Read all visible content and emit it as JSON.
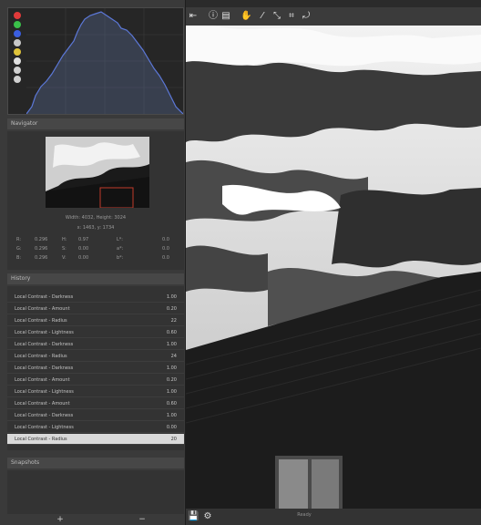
{
  "histogram": {
    "channel_buttons": [
      {
        "name": "red-channel",
        "color": "#e03a3a"
      },
      {
        "name": "green-channel",
        "color": "#3ac04a"
      },
      {
        "name": "blue-channel",
        "color": "#3a5ee0"
      },
      {
        "name": "luminance-channel",
        "color": "#c8c8c8"
      },
      {
        "name": "chroma-channel",
        "color": "#e0c43a"
      },
      {
        "name": "raw-channel",
        "color": "#e0e0e0"
      },
      {
        "name": "bar-toggle",
        "color": "#d0d0d0"
      },
      {
        "name": "mode-toggle",
        "color": "#d0d0d0"
      }
    ]
  },
  "navigator": {
    "title": "Navigator",
    "dimensions": "Width: 4032, Height: 3024",
    "coordinates": "x: 1463, y: 1734",
    "rows": [
      {
        "c1": "R:",
        "c2": "0.296",
        "c3": "H:",
        "c4": "0.97",
        "c5": "L*:",
        "c6": "0.0"
      },
      {
        "c1": "G:",
        "c2": "0.296",
        "c3": "S:",
        "c4": "0.00",
        "c5": "a*:",
        "c6": "0.0"
      },
      {
        "c1": "B:",
        "c2": "0.296",
        "c3": "V:",
        "c4": "0.00",
        "c5": "b*:",
        "c6": "0.0"
      }
    ]
  },
  "history": {
    "title": "History",
    "items": [
      {
        "label": "Local Contrast - Darkness",
        "value": "1.00"
      },
      {
        "label": "Local Contrast - Amount",
        "value": "0.20"
      },
      {
        "label": "Local Contrast - Radius",
        "value": "22"
      },
      {
        "label": "Local Contrast - Lightness",
        "value": "0.60"
      },
      {
        "label": "Local Contrast - Darkness",
        "value": "1.00"
      },
      {
        "label": "Local Contrast - Radius",
        "value": "24"
      },
      {
        "label": "Local Contrast - Darkness",
        "value": "1.00"
      },
      {
        "label": "Local Contrast - Amount",
        "value": "0.20"
      },
      {
        "label": "Local Contrast - Lightness",
        "value": "1.00"
      },
      {
        "label": "Local Contrast - Amount",
        "value": "0.60"
      },
      {
        "label": "Local Contrast - Darkness",
        "value": "1.00"
      },
      {
        "label": "Local Contrast - Lightness",
        "value": "0.00"
      },
      {
        "label": "Local Contrast - Radius",
        "value": "20"
      }
    ],
    "selected_index": 12
  },
  "snapshots": {
    "title": "Snapshots",
    "add_label": "+",
    "remove_label": "−"
  },
  "toolbar": {
    "tools": [
      "hand-tool",
      "info-icon",
      "before-after-icon",
      "pan-icon",
      "color-picker-icon",
      "straighten-icon",
      "crop-icon",
      "rotate-icon"
    ]
  },
  "status": {
    "text": "Ready"
  }
}
